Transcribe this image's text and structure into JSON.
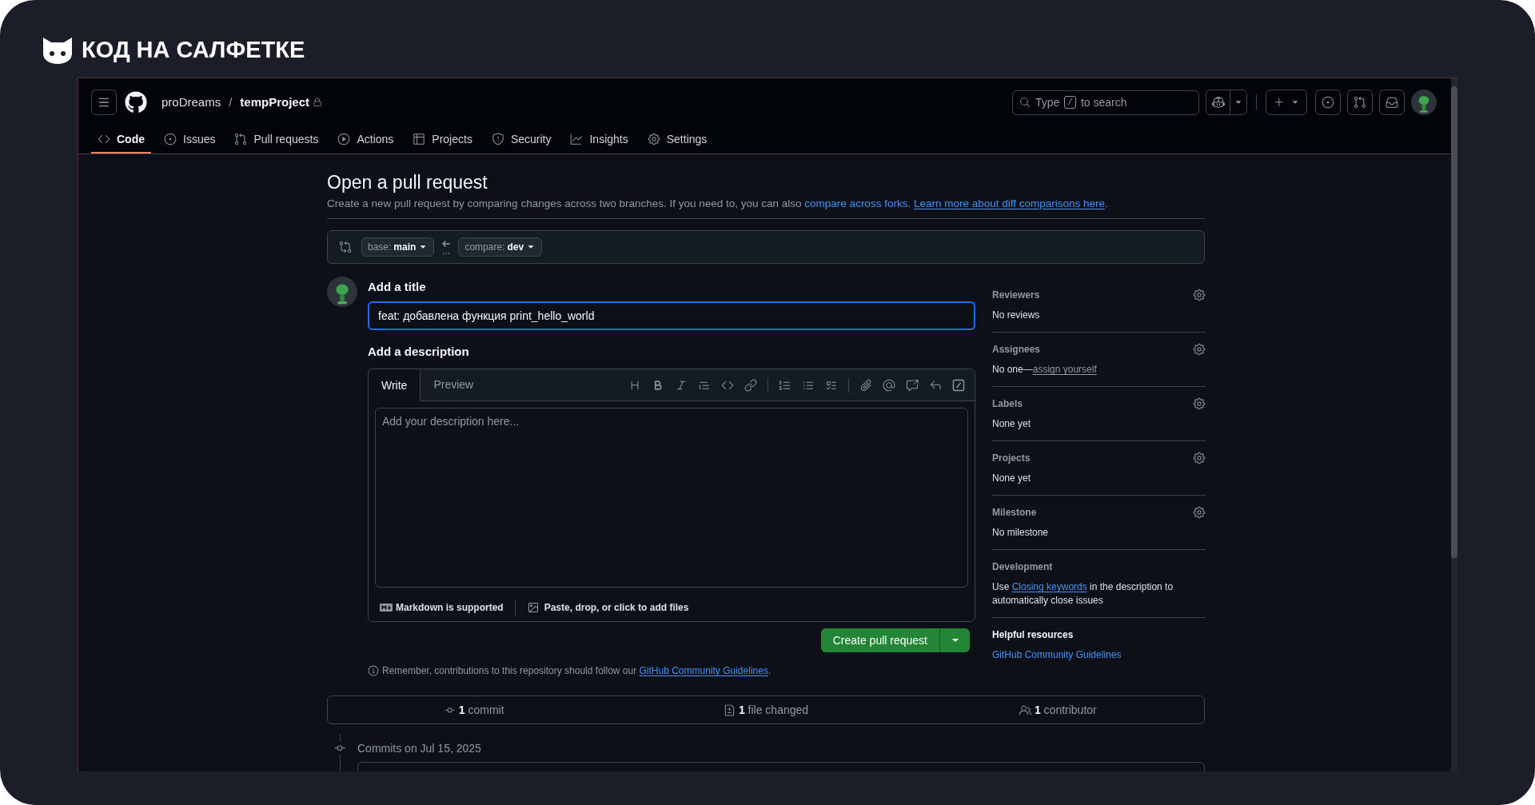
{
  "brand": {
    "name": "КОД НА САЛФЕТКЕ"
  },
  "header": {
    "owner": "proDreams",
    "separator": "/",
    "repo": "tempProject",
    "private": true,
    "search": {
      "before": "Type",
      "key": "/",
      "after": "to search"
    }
  },
  "nav": [
    {
      "label": "Code",
      "selected": true
    },
    {
      "label": "Issues",
      "selected": false
    },
    {
      "label": "Pull requests",
      "selected": false
    },
    {
      "label": "Actions",
      "selected": false
    },
    {
      "label": "Projects",
      "selected": false
    },
    {
      "label": "Security",
      "selected": false
    },
    {
      "label": "Insights",
      "selected": false
    },
    {
      "label": "Settings",
      "selected": false
    }
  ],
  "page": {
    "title": "Open a pull request",
    "subtitle": [
      {
        "kind": "text",
        "text": "Create a new pull request by comparing changes across two branches. If you need to, you can also "
      },
      {
        "kind": "link",
        "text": "compare across forks"
      },
      {
        "kind": "text",
        "text": ". "
      },
      {
        "kind": "underlined_link",
        "text": "Learn more about diff comparisons here"
      },
      {
        "kind": "text",
        "text": "."
      }
    ],
    "base": {
      "label": "base:",
      "value": "main"
    },
    "compare": {
      "label": "compare:",
      "value": "dev"
    }
  },
  "form": {
    "title_label": "Add a title",
    "title_value": "feat: добавлена функция print_hello_world",
    "title_focused": true,
    "description_label": "Add a description",
    "tabs": [
      {
        "label": "Write",
        "selected": true
      },
      {
        "label": "Preview",
        "selected": false
      }
    ],
    "placeholder": "Add your description here...",
    "markdown_note": "Markdown is supported",
    "attach_note": "Paste, drop, or click to add files",
    "submit": "Create pull request",
    "reminder": [
      {
        "kind": "text",
        "text": "Remember, contributions to this repository should follow our "
      },
      {
        "kind": "underlined_link",
        "text": "GitHub Community Guidelines"
      },
      {
        "kind": "text",
        "text": "."
      }
    ]
  },
  "sidebar": [
    {
      "kind": "setting",
      "title": "Reviewers",
      "value": [
        {
          "kind": "text",
          "text": "No reviews"
        }
      ]
    },
    {
      "kind": "setting",
      "title": "Assignees",
      "value": [
        {
          "kind": "text",
          "text": "No one—"
        },
        {
          "kind": "muted_link",
          "text": "assign yourself"
        }
      ]
    },
    {
      "kind": "setting",
      "title": "Labels",
      "value": [
        {
          "kind": "text",
          "text": "None yet"
        }
      ]
    },
    {
      "kind": "setting",
      "title": "Projects",
      "value": [
        {
          "kind": "text",
          "text": "None yet"
        }
      ]
    },
    {
      "kind": "setting",
      "title": "Milestone",
      "value": [
        {
          "kind": "text",
          "text": "No milestone"
        }
      ]
    },
    {
      "kind": "info",
      "title": "Development",
      "value": [
        {
          "kind": "text",
          "text": "Use "
        },
        {
          "kind": "underlined_link",
          "text": "Closing keywords"
        },
        {
          "kind": "text",
          "text": " in the description to automatically close issues"
        }
      ]
    },
    {
      "kind": "resources",
      "title": "Helpful resources",
      "value": [
        {
          "kind": "link",
          "text": "GitHub Community Guidelines"
        }
      ]
    }
  ],
  "stats": [
    {
      "count": "1",
      "label": "commit"
    },
    {
      "count": "1",
      "label": "file changed"
    },
    {
      "count": "1",
      "label": "contributor"
    }
  ],
  "commits": {
    "heading": "Commits on Jul 15, 2025"
  }
}
